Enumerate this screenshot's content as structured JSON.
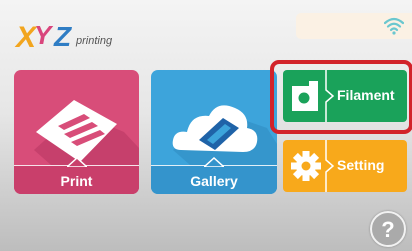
{
  "header": {
    "logo_text": "XYZprinting",
    "wifi_icon": "wifi-icon"
  },
  "tiles": {
    "print": {
      "label": "Print",
      "icon": "print-icon",
      "color": "#d84d79"
    },
    "gallery": {
      "label": "Gallery",
      "icon": "cloud-icon",
      "color": "#3da4db"
    },
    "filament": {
      "label": "Filament",
      "icon": "filament-cartridge-icon",
      "color": "#1aa25a"
    },
    "setting": {
      "label": "Setting",
      "icon": "gear-icon",
      "color": "#f8a91b"
    }
  },
  "highlight": {
    "target": "filament",
    "color": "#d2232a"
  },
  "help": {
    "label": "?",
    "icon": "help-icon"
  }
}
